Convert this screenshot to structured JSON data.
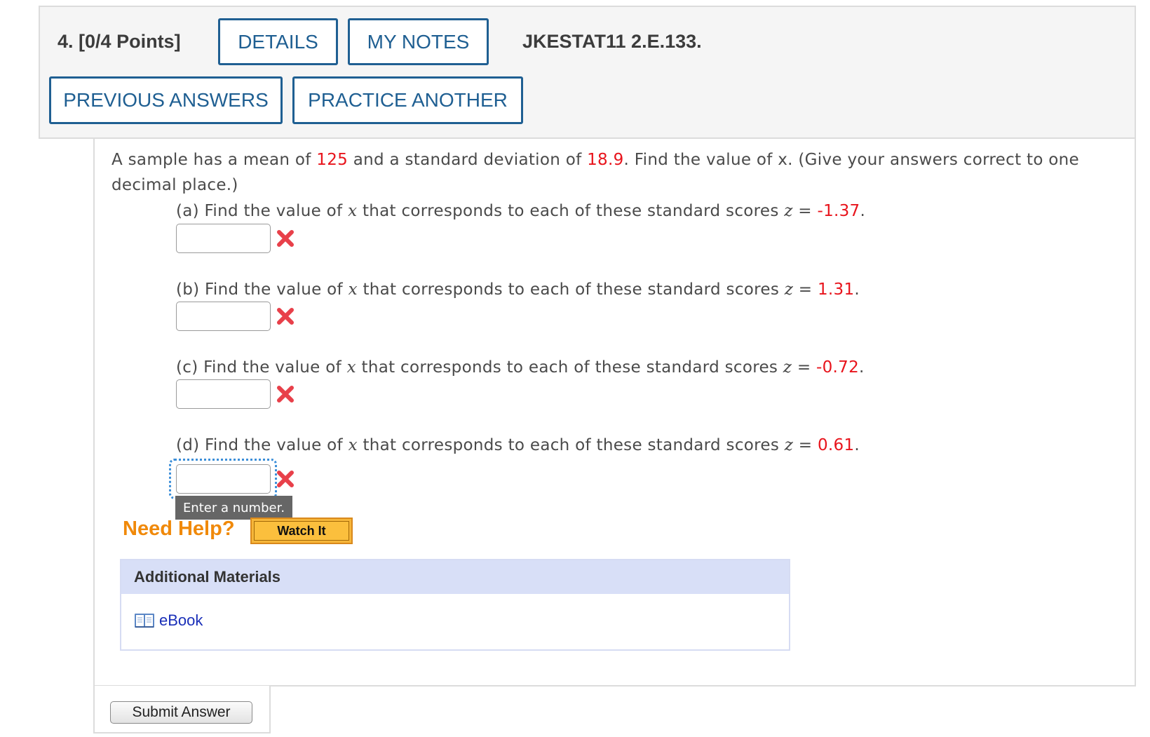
{
  "header": {
    "question_number": "4.",
    "points": "[0/4 Points]",
    "details_label": "DETAILS",
    "my_notes_label": "MY NOTES",
    "problem_code": "JKESTAT11 2.E.133.",
    "previous_answers_label": "PREVIOUS ANSWERS",
    "practice_another_label": "PRACTICE ANOTHER"
  },
  "problem": {
    "intro_prefix": "A sample has a mean of ",
    "mean": "125",
    "intro_middle": " and a standard deviation of ",
    "std_dev": "18.9",
    "intro_suffix": ". Find the value of x. (Give your answers correct to one decimal place.)",
    "parts": [
      {
        "label": "(a) Find the value of ",
        "var": "x",
        "text": " that corresponds to each of these standard scores ",
        "zvar": "z",
        "eq": " = ",
        "z_value": "-1.37",
        "end": ".",
        "answer": "",
        "status": "incorrect"
      },
      {
        "label": "(b) Find the value of ",
        "var": "x",
        "text": " that corresponds to each of these standard scores ",
        "zvar": "z",
        "eq": " = ",
        "z_value": "1.31",
        "end": ".",
        "answer": "",
        "status": "incorrect"
      },
      {
        "label": "(c) Find the value of ",
        "var": "x",
        "text": " that corresponds to each of these standard scores ",
        "zvar": "z",
        "eq": " = ",
        "z_value": "-0.72",
        "end": ".",
        "answer": "",
        "status": "incorrect"
      },
      {
        "label": "(d) Find the value of ",
        "var": "x",
        "text": " that corresponds to each of these standard scores ",
        "zvar": "z",
        "eq": " = ",
        "z_value": "0.61",
        "end": ".",
        "answer": "",
        "status": "incorrect"
      }
    ],
    "tooltip": "Enter a number."
  },
  "help": {
    "need_help": "Need Help?",
    "watch_it": "Watch It"
  },
  "materials": {
    "heading": "Additional Materials",
    "ebook_label": "eBook",
    "ebook_icon": "book-icon"
  },
  "submit_label": "Submit Answer",
  "colors": {
    "accent_blue": "#1f5f92",
    "value_red": "#e8141c",
    "help_orange": "#f0890a",
    "incorrect_x": "#e8404a"
  }
}
